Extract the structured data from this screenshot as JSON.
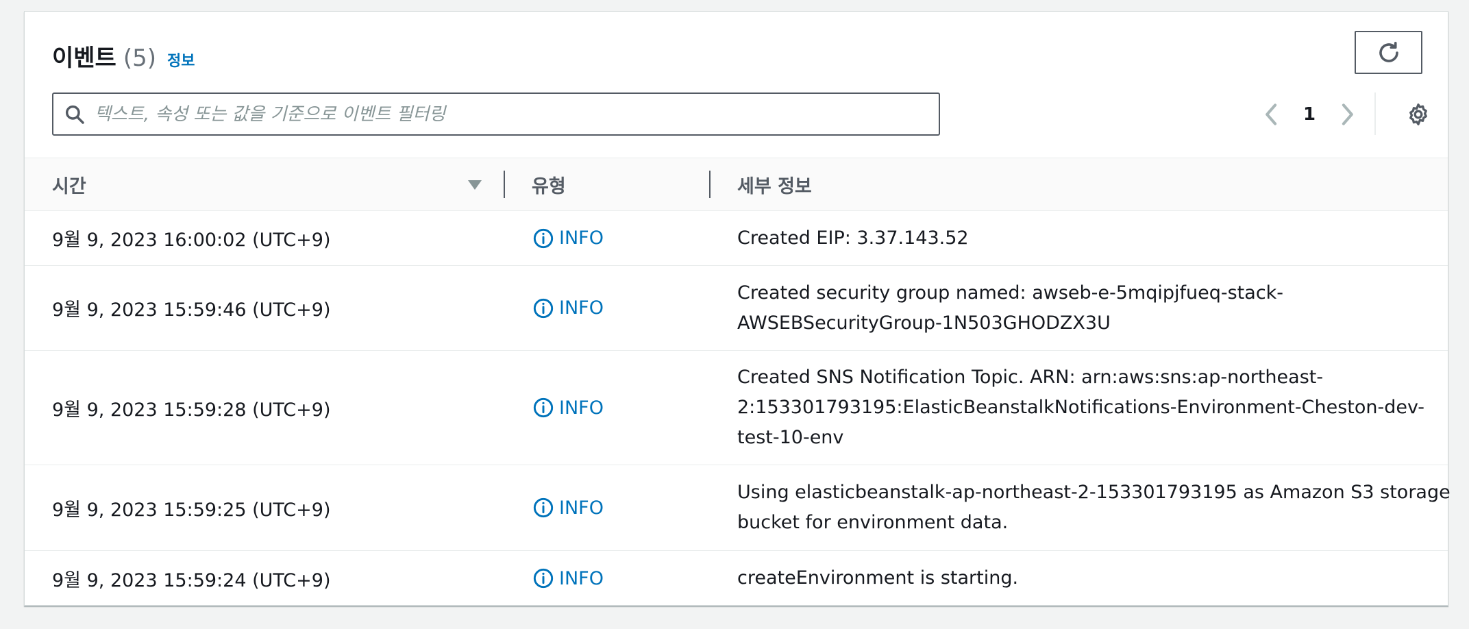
{
  "header": {
    "title": "이벤트",
    "count": "(5)",
    "info_link": "정보"
  },
  "search": {
    "placeholder": "텍스트, 속성 또는 값을 기준으로 이벤트 필터링",
    "value": ""
  },
  "pagination": {
    "current_page": "1"
  },
  "table": {
    "columns": {
      "time": "시간",
      "type": "유형",
      "detail": "세부 정보"
    },
    "rows": [
      {
        "time": "9월 9, 2023 16:00:02 (UTC+9)",
        "type": "INFO",
        "detail_lines": [
          "Created EIP: 3.37.143.52"
        ]
      },
      {
        "time": "9월 9, 2023 15:59:46 (UTC+9)",
        "type": "INFO",
        "detail_lines": [
          "Created security group named: awseb-e-5mqipjfueq-stack-",
          "AWSEBSecurityGroup-1N503GHODZX3U"
        ]
      },
      {
        "time": "9월 9, 2023 15:59:28 (UTC+9)",
        "type": "INFO",
        "detail_lines": [
          "Created SNS Notification Topic. ARN: arn:aws:sns:ap-northeast-",
          "2:153301793195:ElasticBeanstalkNotifications-Environment-Cheston-dev-",
          "test-10-env"
        ]
      },
      {
        "time": "9월 9, 2023 15:59:25 (UTC+9)",
        "type": "INFO",
        "detail_lines": [
          "Using elasticbeanstalk-ap-northeast-2-153301793195 as Amazon S3 storage",
          "bucket for environment data."
        ]
      },
      {
        "time": "9월 9, 2023 15:59:24 (UTC+9)",
        "type": "INFO",
        "detail_lines": [
          "createEnvironment is starting."
        ]
      }
    ]
  },
  "icons": {
    "refresh": "refresh-icon",
    "search": "search-icon",
    "prev": "chevron-left-icon",
    "next": "chevron-right-icon",
    "settings": "gear-icon",
    "sort": "caret-down-icon",
    "info": "info-circle-icon"
  },
  "colors": {
    "link": "#0073bb",
    "text": "#16191f",
    "muted": "#545b64",
    "disabled": "#aab7b8",
    "background": "#f2f3f3"
  }
}
